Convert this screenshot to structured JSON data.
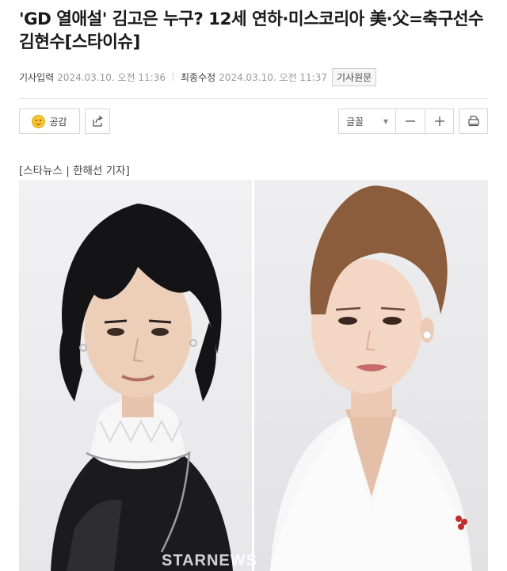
{
  "article": {
    "title": "'GD 열애설' 김고은 누구? 12세 연하·미스코리아 美·父=축구선수 김현수[스타이슈]",
    "published_label": "기사입력",
    "published_value": "2024.03.10. 오전 11:36",
    "updated_label": "최종수정",
    "updated_value": "2024.03.10. 오전 11:37",
    "original_button": "기사원문",
    "byline": "[스타뉴스 | 한해선 기자]"
  },
  "toolbar": {
    "like_label": "공감",
    "font_label": "글꼴",
    "icons": [
      "smile-icon",
      "share-icon",
      "chevron-down-icon",
      "minus-icon",
      "plus-icon",
      "print-icon"
    ]
  },
  "photos": {
    "watermark": "STARNEWS",
    "left": "man-portrait",
    "right": "woman-portrait"
  },
  "colors": {
    "text": "#1a1a1a",
    "meta": "#999999",
    "border": "#d6d6d6",
    "smile": "#f6c431"
  }
}
